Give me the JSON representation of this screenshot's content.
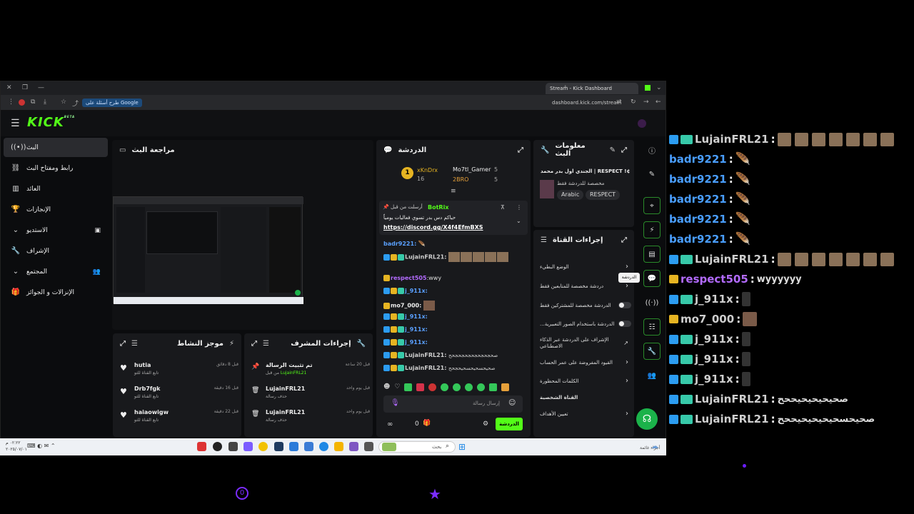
{
  "browser": {
    "tab_title": "Stream - Kick Dashboard",
    "url": "dashboard.kick.com/stream",
    "google_chip": "طرح أسئلة على Google"
  },
  "logo": {
    "text": "KICK",
    "beta": "BETA"
  },
  "sidebar": {
    "items": [
      {
        "label": "البث",
        "icon": "broadcast-icon"
      },
      {
        "label": "رابط ومفتاح البث",
        "icon": "link-icon"
      },
      {
        "label": "العائد",
        "icon": "chart-icon"
      },
      {
        "label": "الإنجازات",
        "icon": "trophy-icon"
      },
      {
        "label": "الاستديو",
        "icon": "chevron-down-icon"
      },
      {
        "label": "الإشراف",
        "icon": "wrench-icon"
      },
      {
        "label": "المجتمع",
        "icon": "chevron-down-icon"
      },
      {
        "label": "الإنزالات و الجوائز",
        "icon": "gift-icon"
      }
    ]
  },
  "preview": {
    "title": "مراجعة البث"
  },
  "activity": {
    "title": "موجز النشاط",
    "items": [
      {
        "name": "hutia",
        "sub": "تابع القناة للتو",
        "time": "قبل 8 دقائق"
      },
      {
        "name": "Drb7fgk",
        "sub": "تابع القناة للتو",
        "time": "قبل 16 دقيقة"
      },
      {
        "name": "haiaowigw",
        "sub": "تابع القناة للتو",
        "time": "قبل 22 دقيقة"
      }
    ]
  },
  "mod_actions": {
    "title": "إجراءات المشرف",
    "items": [
      {
        "title": "تم تثبيت الرسالة",
        "sub": "من قبل",
        "user": "LujainFRL21",
        "time": "قبل 20 ساعة"
      },
      {
        "title": "LujainFRL21",
        "sub": "حذف رسالة",
        "time": "قبل يوم واحد"
      },
      {
        "title": "LujainFRL21",
        "sub": "حذف رسالة",
        "time": "قبل يوم واحد"
      }
    ]
  },
  "chat": {
    "title": "الدردشة",
    "top_gifters": [
      {
        "name": "xKnDrx",
        "count": "16",
        "rank": "1"
      },
      {
        "name": "Mo7tl_Gamer",
        "count": "5"
      },
      {
        "name": "2BRO",
        "count": "5"
      }
    ],
    "pinned": {
      "header": "أرسلت من قبل",
      "bot": "BotRix",
      "text": "حياكم دس بدر تسوي فعاليات يومياً",
      "link": "https://discord.gg/X4f4EfmBXS"
    },
    "messages": [
      {
        "user": "badr9221:",
        "color": "#5aa0ff"
      },
      {
        "user": "LujainFRL21:",
        "color": "#cfcfcf"
      },
      {
        "user": "respect505",
        "color": "#b36bff",
        "text": ":wwy"
      },
      {
        "user": "j_911x:",
        "color": "#5aa0ff"
      },
      {
        "user": "mo7_000:",
        "color": "#eee"
      },
      {
        "user": "j_911x:",
        "color": "#5aa0ff"
      },
      {
        "user": "j_911x:",
        "color": "#5aa0ff"
      },
      {
        "user": "j_911x:",
        "color": "#5aa0ff"
      },
      {
        "user": "LujainFRL21:",
        "color": "#cfcfcf",
        "text": "صحجحجحجحجحجحجحح"
      },
      {
        "user": "LujainFRL21:",
        "color": "#cfcfcf",
        "text": "صحيحسحيحسحيحجحح"
      }
    ],
    "input_placeholder": "إرسال رسالة",
    "send_button": "الدردشة",
    "counter": "0",
    "infinity": "∞"
  },
  "stream_info": {
    "title": "معلومات البث",
    "stream_title": "الجندي اول بدر محمد | RESPECT !¢",
    "category": "مخصصة للدردشة فقط",
    "tags": [
      "Arabic",
      "RESPECT"
    ]
  },
  "channel_actions": {
    "title": "إجراءات القناة",
    "settings": [
      {
        "label": "الوضع البطيء",
        "type": "arrow"
      },
      {
        "label": "دردشة مخصصة للمتابعين فقط",
        "type": "arrow"
      },
      {
        "label": "الدردشة مخصصة للمشتركين فقط",
        "type": "toggle"
      },
      {
        "label": "...الدردشة باستخدام الصور التعبيرية",
        "type": "toggle"
      },
      {
        "label": "الإشراف على الدردشة عبر الذكاء الاصطناعي",
        "type": "ext"
      },
      {
        "label": "القيود المفروضة على عمر الحساب",
        "type": "arrow"
      },
      {
        "label": "الكلمات المحظورة",
        "type": "arrow"
      },
      {
        "label": "القناة الشخصية",
        "type": "none"
      },
      {
        "label": "تعيين الأهداف",
        "type": "arrow"
      }
    ],
    "tooltip": "الدردشة"
  },
  "taskbar": {
    "search": "بحث",
    "clock": "٠٢:٢٢ م",
    "date": "٢٠٢٥/٠٧/٠١",
    "weather": "أجزاء غائمة"
  },
  "overlay_chat": [
    {
      "user": "LujainFRL21",
      "color": "#cfcfcf",
      "kind": "emotes",
      "badges": true
    },
    {
      "user": "badr9221",
      "color": "#4a9eff",
      "kind": "feather"
    },
    {
      "user": "badr9221",
      "color": "#4a9eff",
      "kind": "feather"
    },
    {
      "user": "badr9221",
      "color": "#4a9eff",
      "kind": "feather"
    },
    {
      "user": "badr9221",
      "color": "#4a9eff",
      "kind": "feather"
    },
    {
      "user": "badr9221",
      "color": "#4a9eff",
      "kind": "feather"
    },
    {
      "user": "LujainFRL21",
      "color": "#cfcfcf",
      "kind": "emotes",
      "badges": true
    },
    {
      "user": "respect505",
      "color": "#b36bff",
      "kind": "text",
      "text": "wyyyyyy",
      "crown": true
    },
    {
      "user": "j_911x",
      "color": "#cfcfcf",
      "kind": "figure",
      "badges": true
    },
    {
      "user": "mo7_000",
      "color": "#cfcfcf",
      "kind": "face",
      "crown": true
    },
    {
      "user": "j_911x",
      "color": "#cfcfcf",
      "kind": "figure",
      "badges": true
    },
    {
      "user": "j_911x",
      "color": "#cfcfcf",
      "kind": "figure",
      "badges": true
    },
    {
      "user": "j_911x",
      "color": "#cfcfcf",
      "kind": "figure",
      "badges": true
    },
    {
      "user": "LujainFRL21",
      "color": "#cfcfcf",
      "kind": "text",
      "text": "صحيحيحيحيححح",
      "badges": true
    },
    {
      "user": "LujainFRL21",
      "color": "#cfcfcf",
      "kind": "text",
      "text": "صحيحسحيحيحيحيححح",
      "badges": true
    }
  ],
  "colors": {
    "kick_green": "#53fc18",
    "panel": "#18191c",
    "bg": "#0b0c0e",
    "accent_purple": "#7b2cff"
  }
}
